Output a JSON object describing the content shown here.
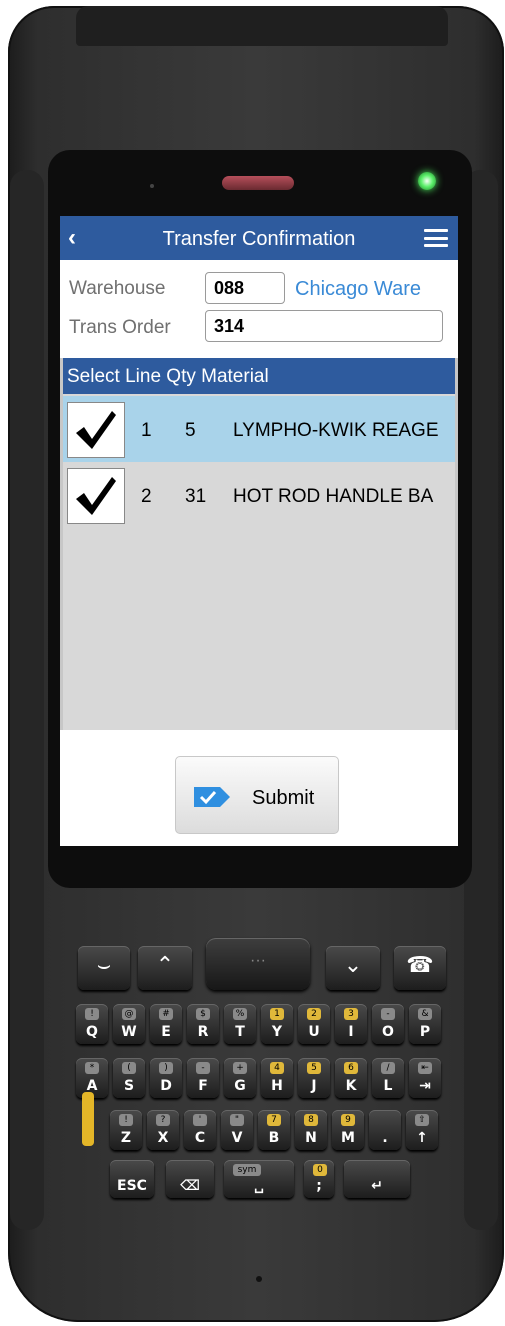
{
  "header": {
    "title": "Transfer Confirmation"
  },
  "form": {
    "warehouse_label": "Warehouse",
    "warehouse_value": "088",
    "warehouse_name": "Chicago Ware",
    "trans_order_label": "Trans Order",
    "trans_order_value": "314"
  },
  "list": {
    "columns": [
      "Select",
      "Line",
      "Qty",
      "Material"
    ],
    "header_text": "Select Line Qty Material",
    "rows": [
      {
        "checked": true,
        "line": "1",
        "qty": "5",
        "material": "LYMPHO-KWIK REAGE"
      },
      {
        "checked": true,
        "line": "2",
        "qty": "31",
        "material": "HOT ROD HANDLE BA"
      }
    ]
  },
  "submit": {
    "label": "Submit"
  },
  "colors": {
    "header_bg": "#2e5b9e",
    "selected_row": "#a9d3ea",
    "link_blue": "#3a8ad6",
    "device_body": "#2e2e2e"
  },
  "keypad": {
    "function_keys": [
      "call-icon",
      "scroll-up-icon",
      "scroll-down-icon",
      "end-call-icon"
    ],
    "nav_center": "···",
    "row1": [
      {
        "main": "Q",
        "sub": "!"
      },
      {
        "main": "W",
        "sub": "@"
      },
      {
        "main": "E",
        "sub": "#"
      },
      {
        "main": "R",
        "sub": "$"
      },
      {
        "main": "T",
        "sub": "%"
      },
      {
        "main": "Y",
        "sub": "1"
      },
      {
        "main": "U",
        "sub": "2"
      },
      {
        "main": "I",
        "sub": "3"
      },
      {
        "main": "O",
        "sub": "-"
      },
      {
        "main": "P",
        "sub": "&"
      }
    ],
    "row2": [
      {
        "main": "A",
        "sub": "*"
      },
      {
        "main": "S",
        "sub": "("
      },
      {
        "main": "D",
        "sub": ")"
      },
      {
        "main": "F",
        "sub": "-"
      },
      {
        "main": "G",
        "sub": "+"
      },
      {
        "main": "H",
        "sub": "4"
      },
      {
        "main": "J",
        "sub": "5"
      },
      {
        "main": "K",
        "sub": "6"
      },
      {
        "main": "L",
        "sub": "/"
      },
      {
        "main": "⇥",
        "sub": "⇤"
      }
    ],
    "row3": [
      {
        "main": "Z",
        "sub": "!"
      },
      {
        "main": "X",
        "sub": "?"
      },
      {
        "main": "C",
        "sub": "'"
      },
      {
        "main": "V",
        "sub": "\""
      },
      {
        "main": "B",
        "sub": "7"
      },
      {
        "main": "N",
        "sub": "8"
      },
      {
        "main": "M",
        "sub": "9"
      },
      {
        "main": ".",
        "sub": ""
      },
      {
        "main": "↑",
        "sub": "⇧"
      }
    ],
    "row4": [
      {
        "main": "ESC"
      },
      {
        "main": "⌫"
      },
      {
        "main": "␣",
        "sub": "sym"
      },
      {
        "main": ";",
        "sub": "0"
      },
      {
        "main": "↵"
      }
    ]
  }
}
